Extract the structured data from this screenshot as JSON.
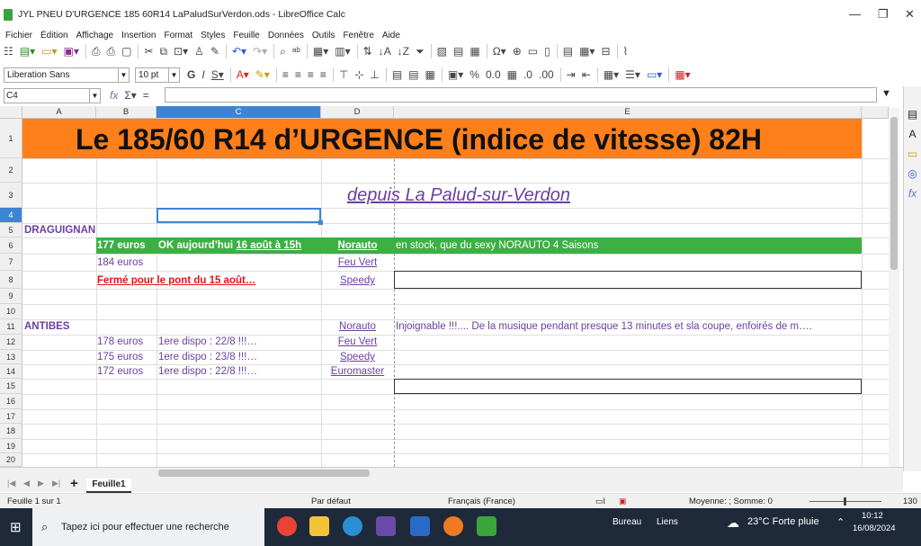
{
  "window": {
    "title": "JYL   PNEU D'URGENCE 185 60R14  LaPaludSurVerdon.ods - LibreOffice Calc",
    "minimize": "—",
    "restore": "❐",
    "close": "✕"
  },
  "menu": [
    "Fichier",
    "Édition",
    "Affichage",
    "Insertion",
    "Format",
    "Styles",
    "Feuille",
    "Données",
    "Outils",
    "Fenêtre",
    "Aide"
  ],
  "format": {
    "font_name": "Liberation Sans",
    "font_size": "10 pt"
  },
  "formula": {
    "cell_ref": "C4",
    "value": ""
  },
  "columns": [
    "A",
    "B",
    "C",
    "D",
    "E"
  ],
  "rows": [
    "1",
    "2",
    "3",
    "4",
    "5",
    "6",
    "7",
    "8",
    "9",
    "10",
    "11",
    "12",
    "13",
    "14",
    "15",
    "16",
    "17",
    "18",
    "19",
    "20"
  ],
  "cells": {
    "title": "Le 185/60 R14 d’URGENCE  (indice de vitesse) 82H",
    "subtitle": "depuis La Palud-sur-Verdon",
    "draguignan": "DRAGUIGNAN",
    "r6b": "177 euros",
    "r6c_a": "OK aujourd’hui ",
    "r6c_b": "16 août à 15h",
    "r6d": "Norauto",
    "r6e": "en stock, que du sexy NORAUTO 4 Saisons",
    "r7b": "184 euros",
    "r7d": "Feu Vert",
    "r8b": "Fermé pour le pont du 15 août…",
    "r8d": "Speedy",
    "antibes": "ANTIBES",
    "r11d": "Norauto",
    "r11e": "Injoignable !!!.... De la musique pendant presque 13 minutes et sla coupe, enfoirés de m….",
    "r12b": "178 euros",
    "r12c": "1ere dispo : 22/8 !!!…",
    "r12d": "Feu Vert",
    "r13b": "175 euros",
    "r13c": "1ere dispo : 23/8 !!!…",
    "r13d": "Speedy",
    "r14b": "172 euros",
    "r14c": "1ere dispo : 22/8 !!!…",
    "r14d": "Euromaster"
  },
  "sheet_tab": "Feuille1",
  "status": {
    "sheet": "Feuille 1 sur 1",
    "style": "Par défaut",
    "lang": "Français (France)",
    "stats": "Moyenne: ; Somme: 0",
    "zoom": "130 %"
  },
  "taskbar": {
    "search": "Tapez ici pour effectuer une recherche",
    "bureau": "Bureau",
    "liens": "Liens",
    "weather": "23°C  Forte pluie",
    "time": "10:12",
    "date": "16/08/2024"
  },
  "colors": {
    "orange": "#ff7f1a",
    "green": "#3cb043",
    "purple": "#6b3fa0",
    "red": "#e0141e",
    "select_blue": "#3c85d6"
  }
}
